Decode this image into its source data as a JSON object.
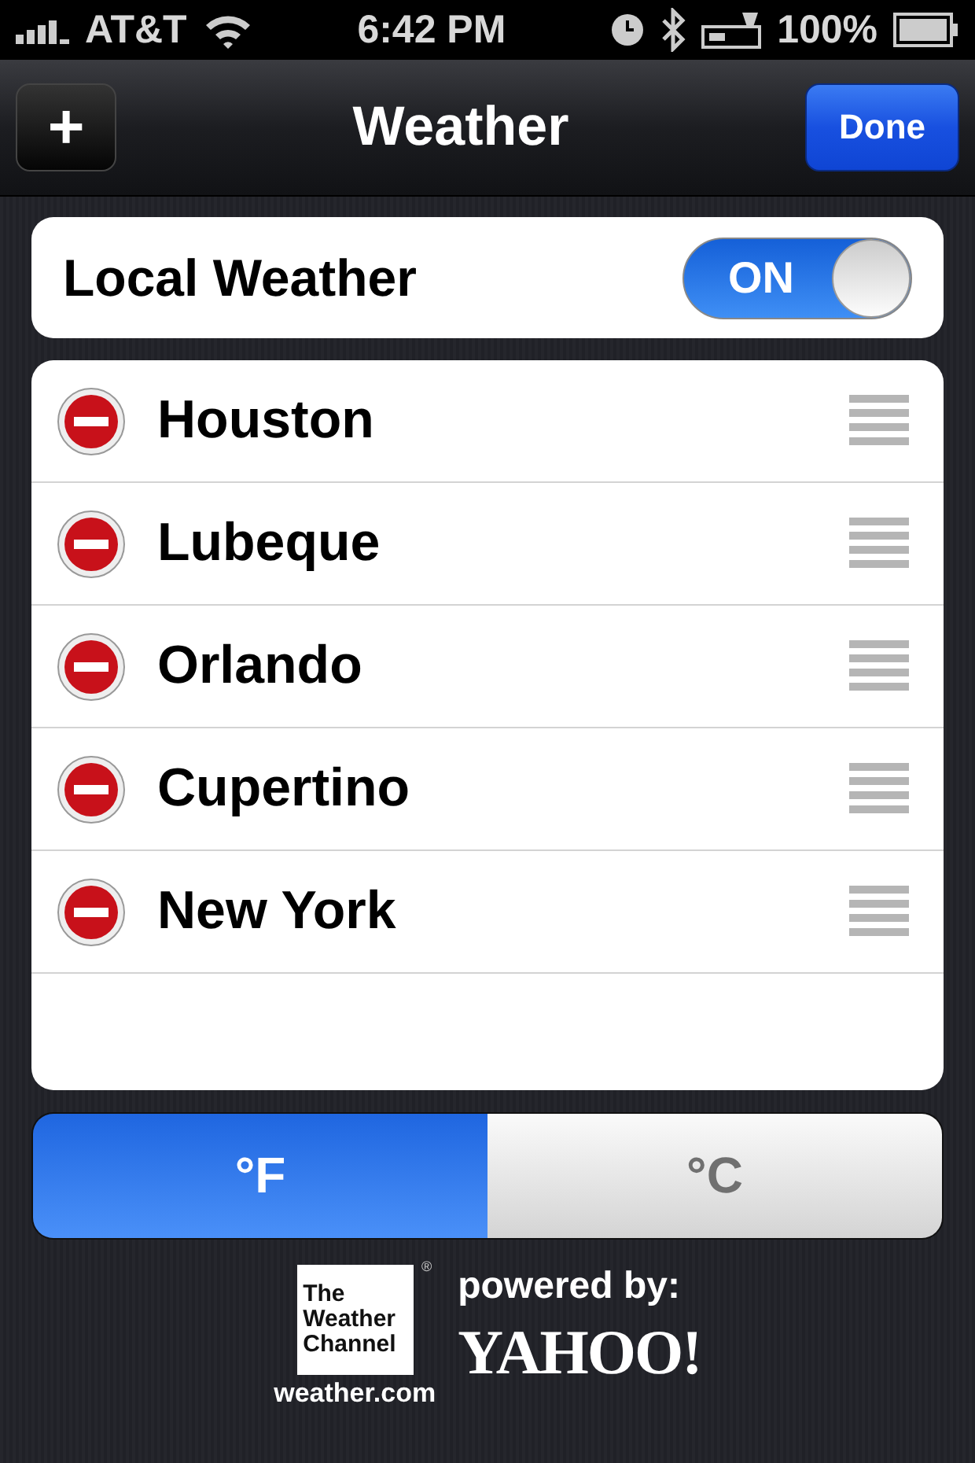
{
  "status_bar": {
    "carrier": "AT&T",
    "time": "6:42 PM",
    "battery": "100%"
  },
  "nav": {
    "add": "+",
    "title": "Weather",
    "done": "Done"
  },
  "local_weather": {
    "label": "Local Weather",
    "on": true,
    "on_text": "ON"
  },
  "cities": [
    {
      "name": "Houston"
    },
    {
      "name": "Lubeque"
    },
    {
      "name": "Orlando"
    },
    {
      "name": "Cupertino"
    },
    {
      "name": "New York"
    }
  ],
  "units": [
    {
      "label": "°F",
      "selected": true
    },
    {
      "label": "°C",
      "selected": false
    }
  ],
  "footer": {
    "twc_lines": [
      "The",
      "Weather",
      "Channel"
    ],
    "registered": "®",
    "twc_site": "weather.com",
    "powered": "powered by:",
    "yahoo": "YAHOO!"
  }
}
